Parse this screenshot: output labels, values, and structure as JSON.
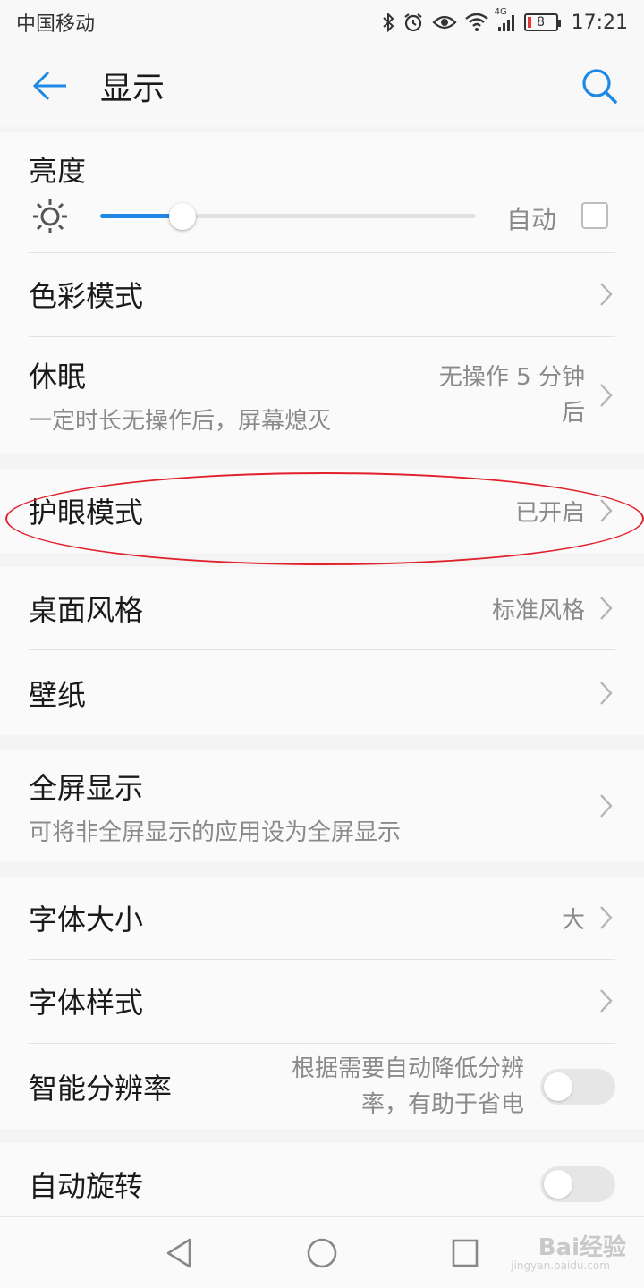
{
  "status_bar": {
    "carrier": "中国移动",
    "network": "4G",
    "battery": "8",
    "time": "17:21",
    "icons": [
      "bluetooth-icon",
      "alarm-icon",
      "eye-icon",
      "wifi-icon",
      "signal-icon",
      "battery-icon"
    ]
  },
  "app_bar": {
    "title": "显示"
  },
  "brightness": {
    "label": "亮度",
    "auto_label": "自动",
    "level": 0.22,
    "auto_checked": false
  },
  "items": {
    "color_mode": {
      "label": "色彩模式"
    },
    "sleep": {
      "label": "休眠",
      "sub": "一定时长无操作后，屏幕熄灭",
      "value_line1": "无操作 5 分钟",
      "value_line2": "后"
    },
    "eye_comfort": {
      "label": "护眼模式",
      "value": "已开启"
    },
    "home_style": {
      "label": "桌面风格",
      "value": "标准风格"
    },
    "wallpaper": {
      "label": "壁纸"
    },
    "fullscreen": {
      "label": "全屏显示",
      "sub": "可将非全屏显示的应用设为全屏显示"
    },
    "font_size": {
      "label": "字体大小",
      "value": "大"
    },
    "font_style": {
      "label": "字体样式"
    },
    "smart_resolution": {
      "label": "智能分辨率",
      "value_line1": "根据需要自动降低分辨",
      "value_line2": "率，有助于省电",
      "on": false
    },
    "auto_rotate": {
      "label": "自动旋转",
      "on": false
    }
  },
  "watermark": {
    "text": "Bai经验",
    "sub": "jingyan.baidu.com"
  },
  "colors": {
    "accent": "#1e88e5",
    "highlight": "#e0202a"
  }
}
